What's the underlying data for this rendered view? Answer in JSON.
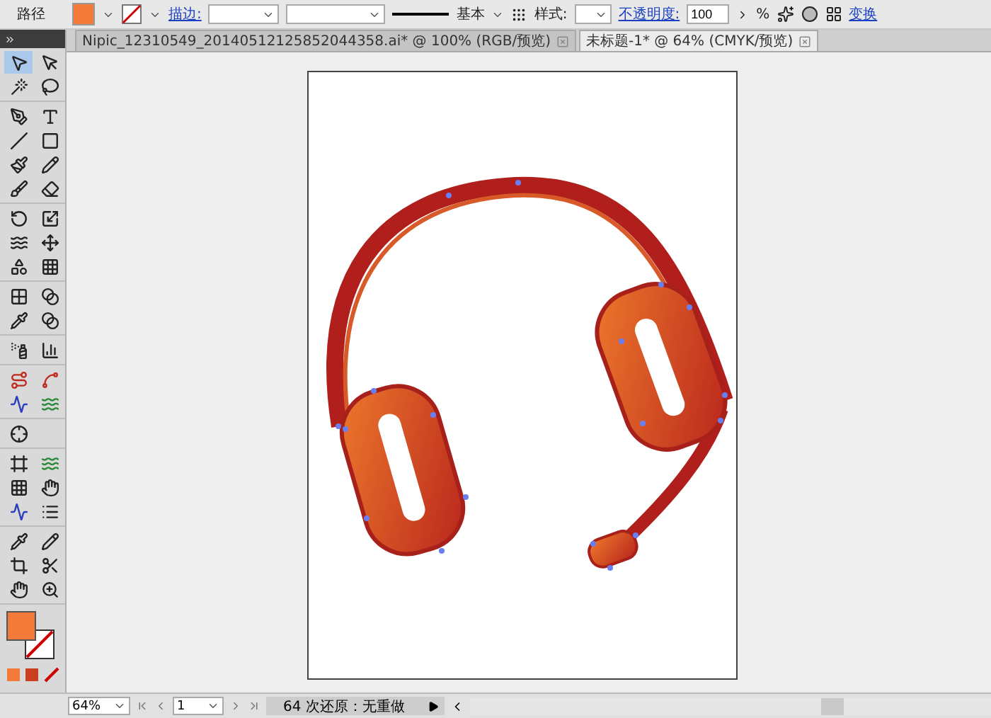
{
  "control_bar": {
    "object_type": "路径",
    "stroke_label": "描边:",
    "stroke_profile": "基本",
    "style_label": "样式:",
    "opacity_label": "不透明度:",
    "opacity_value": "100",
    "opacity_unit": "%",
    "transform_label": "变换"
  },
  "tabs": [
    {
      "label": "Nipic_12310549_20140512125852044358.ai* @ 100% (RGB/预览)",
      "selected": false
    },
    {
      "label": "未标题-1* @ 64% (CMYK/预览)",
      "selected": true
    }
  ],
  "toolbox": {
    "groups": [
      [
        {
          "kind": "select",
          "selected": true
        },
        {
          "kind": "direct-select",
          "selected": false
        },
        {
          "kind": "wand",
          "selected": false
        },
        {
          "kind": "lasso",
          "selected": false
        }
      ],
      [
        {
          "kind": "pen",
          "selected": false
        },
        {
          "kind": "type",
          "selected": false
        },
        {
          "kind": "line",
          "selected": false
        },
        {
          "kind": "rect",
          "selected": false
        },
        {
          "kind": "brush",
          "selected": false
        },
        {
          "kind": "pencil",
          "selected": false
        },
        {
          "kind": "blob",
          "selected": false
        },
        {
          "kind": "eraser",
          "selected": false
        }
      ],
      [
        {
          "kind": "rotate",
          "selected": false
        },
        {
          "kind": "scale",
          "selected": false
        },
        {
          "kind": "warp",
          "selected": false
        },
        {
          "kind": "transform",
          "selected": false
        },
        {
          "kind": "shapes",
          "selected": false
        },
        {
          "kind": "perspective",
          "selected": false
        }
      ],
      [
        {
          "kind": "mesh",
          "selected": false
        },
        {
          "kind": "gradient",
          "selected": false
        },
        {
          "kind": "eyedropper",
          "selected": false
        },
        {
          "kind": "blend",
          "selected": false
        }
      ],
      [
        {
          "kind": "spray",
          "selected": false
        },
        {
          "kind": "graph",
          "selected": false
        }
      ],
      [
        {
          "kind": "route",
          "selected": false
        },
        {
          "kind": "spline",
          "selected": false
        },
        {
          "kind": "activity",
          "selected": false
        },
        {
          "kind": "waves",
          "selected": false
        }
      ],
      [
        {
          "kind": "crosshair",
          "selected": false
        }
      ],
      [
        {
          "kind": "frame",
          "selected": false
        },
        {
          "kind": "waves",
          "selected": false
        },
        {
          "kind": "grid",
          "selected": false
        },
        {
          "kind": "hand",
          "selected": false
        },
        {
          "kind": "activity",
          "selected": false
        },
        {
          "kind": "list",
          "selected": false
        }
      ],
      [
        {
          "kind": "eyedropper",
          "selected": false
        },
        {
          "kind": "pencil",
          "selected": false
        },
        {
          "kind": "crop",
          "selected": false
        },
        {
          "kind": "knife",
          "selected": false
        },
        {
          "kind": "hand",
          "selected": false
        },
        {
          "kind": "zoom",
          "selected": false
        }
      ]
    ]
  },
  "status_bar": {
    "zoom": "64%",
    "page": "1",
    "status": "64 次还原：无重做"
  }
}
